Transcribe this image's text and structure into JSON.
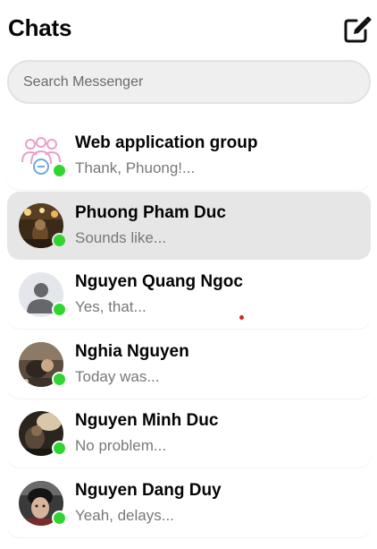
{
  "header": {
    "title": "Chats",
    "compose_icon": "compose-icon"
  },
  "search": {
    "placeholder": "Search Messenger",
    "value": ""
  },
  "chats": [
    {
      "name": "Web application group",
      "preview": "Thank, Phuong!...",
      "online": true,
      "avatar": "group-icon"
    },
    {
      "name": "Phuong Pham Duc",
      "preview": "Sounds like...",
      "online": true,
      "avatar": "photo",
      "active": true
    },
    {
      "name": "Nguyen Quang Ngoc",
      "preview": "Yes, that...",
      "online": true,
      "avatar": "default-user-icon"
    },
    {
      "name": "Nghia Nguyen",
      "preview": "Today was...",
      "online": true,
      "avatar": "photo"
    },
    {
      "name": "Nguyen Minh Duc",
      "preview": "No problem...",
      "online": true,
      "avatar": "photo"
    },
    {
      "name": "Nguyen Dang Duy",
      "preview": "Yeah, delays...",
      "online": true,
      "avatar": "photo"
    }
  ],
  "colors": {
    "online": "#31d531",
    "active_row": "#e6e6e6",
    "preview_text": "#787878",
    "group_icon_pink": "#e8a0c8",
    "group_icon_blue": "#6fa8dc"
  }
}
